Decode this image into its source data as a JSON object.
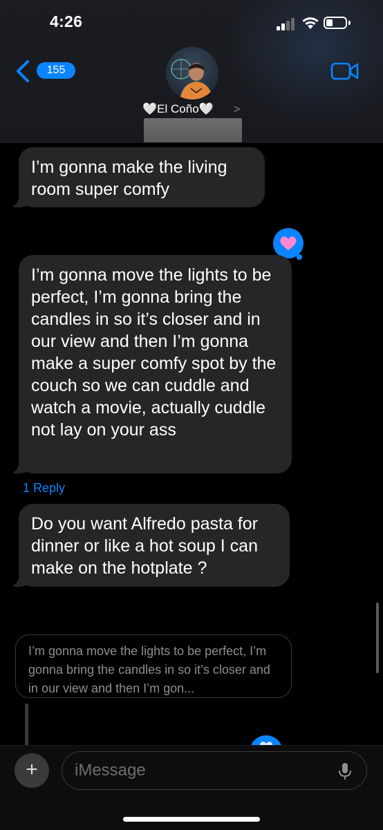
{
  "status_bar": {
    "time": "4:26",
    "battery_percent": 35
  },
  "nav": {
    "back_count": "155",
    "contact_name": "🤍El Coño🤍",
    "chevron": ">"
  },
  "messages": [
    {
      "text": "I’m gonna make the living room super comfy",
      "direction": "incoming"
    },
    {
      "text": "I’m gonna move the lights to be perfect, I’m gonna bring the candles in so it’s closer and in our view and then I’m gonna make a super comfy spot by the couch so we can cuddle and watch a movie, actually cuddle not lay on your ass",
      "direction": "incoming",
      "tapback": "heart"
    },
    {
      "text": "Do you want Alfredo pasta for dinner or like a hot soup I can make on the hotplate ?",
      "direction": "incoming"
    }
  ],
  "reply_link": "1 Reply",
  "quoted_reply": "I’m gonna move the lights to be perfect, I’m gonna bring the candles in so it’s closer and in our view and then I’m gon...",
  "composer": {
    "placeholder": "iMessage",
    "add_button": "+"
  },
  "colors": {
    "accent": "#0a84ff",
    "bubble": "#262628",
    "background": "#000000"
  }
}
